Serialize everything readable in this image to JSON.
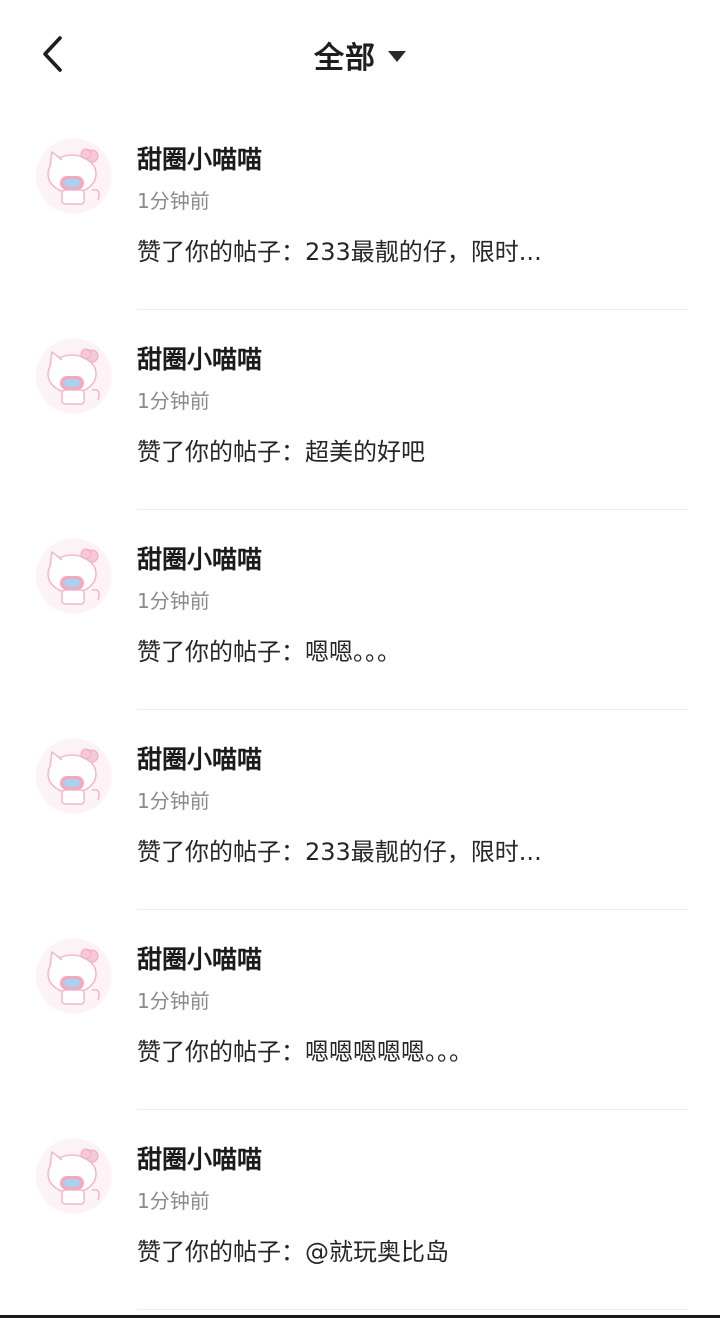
{
  "header": {
    "title": "全部",
    "back_icon": "chevron-left-icon",
    "dropdown_icon": "caret-down-icon"
  },
  "notifications": [
    {
      "user": "甜圈小喵喵",
      "time": "1分钟前",
      "action": "赞了你的帖子：233最靓的仔，限时..."
    },
    {
      "user": "甜圈小喵喵",
      "time": "1分钟前",
      "action": "赞了你的帖子：超美的好吧"
    },
    {
      "user": "甜圈小喵喵",
      "time": "1分钟前",
      "action": "赞了你的帖子：嗯嗯。。。"
    },
    {
      "user": "甜圈小喵喵",
      "time": "1分钟前",
      "action": "赞了你的帖子：233最靓的仔，限时..."
    },
    {
      "user": "甜圈小喵喵",
      "time": "1分钟前",
      "action": "赞了你的帖子：嗯嗯嗯嗯嗯。。。"
    },
    {
      "user": "甜圈小喵喵",
      "time": "1分钟前",
      "action": "赞了你的帖子：@就玩奥比岛"
    }
  ],
  "colors": {
    "title": "#1e1e1e",
    "secondary_text": "#8a8a8a",
    "divider": "#ececec",
    "avatar_pink": "#f7c9d6",
    "avatar_blue": "#a7d3ec"
  }
}
